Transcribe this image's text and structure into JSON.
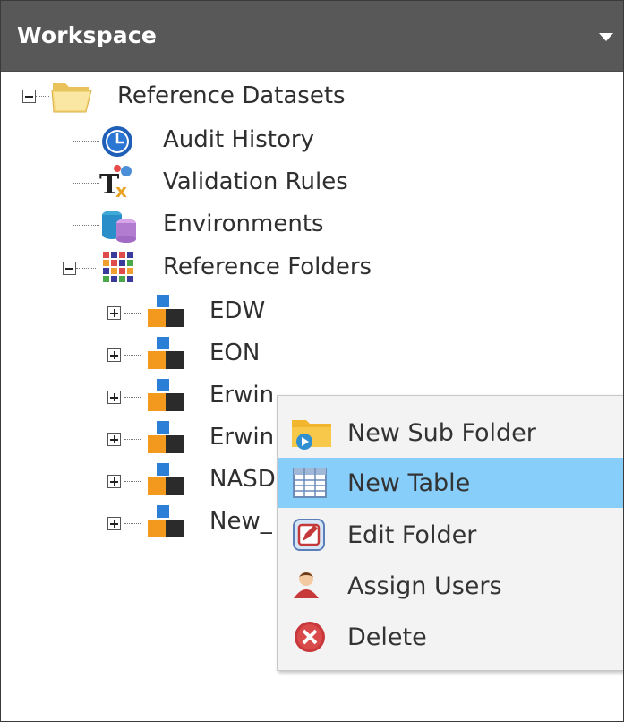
{
  "panel": {
    "title": "Workspace"
  },
  "tree": {
    "root": {
      "label": "Reference Datasets"
    },
    "children": [
      {
        "label": "Audit History"
      },
      {
        "label": "Validation Rules"
      },
      {
        "label": "Environments"
      },
      {
        "label": "Reference Folders"
      }
    ],
    "folders": [
      {
        "label": "EDW"
      },
      {
        "label": "EON"
      },
      {
        "label": "Erwin"
      },
      {
        "label": "Erwin"
      },
      {
        "label": "NASD"
      },
      {
        "label": "New_"
      }
    ]
  },
  "context_menu": {
    "items": [
      {
        "label": "New Sub Folder",
        "icon": "folder-play-icon"
      },
      {
        "label": "New Table",
        "icon": "table-icon",
        "highlighted": true
      },
      {
        "label": "Edit Folder",
        "icon": "edit-icon"
      },
      {
        "label": "Assign Users",
        "icon": "user-icon"
      },
      {
        "label": "Delete",
        "icon": "delete-icon"
      }
    ]
  },
  "colors": {
    "header_bg": "#585858",
    "menu_highlight": "#87cefa",
    "menu_bg": "#f3f3f3"
  }
}
